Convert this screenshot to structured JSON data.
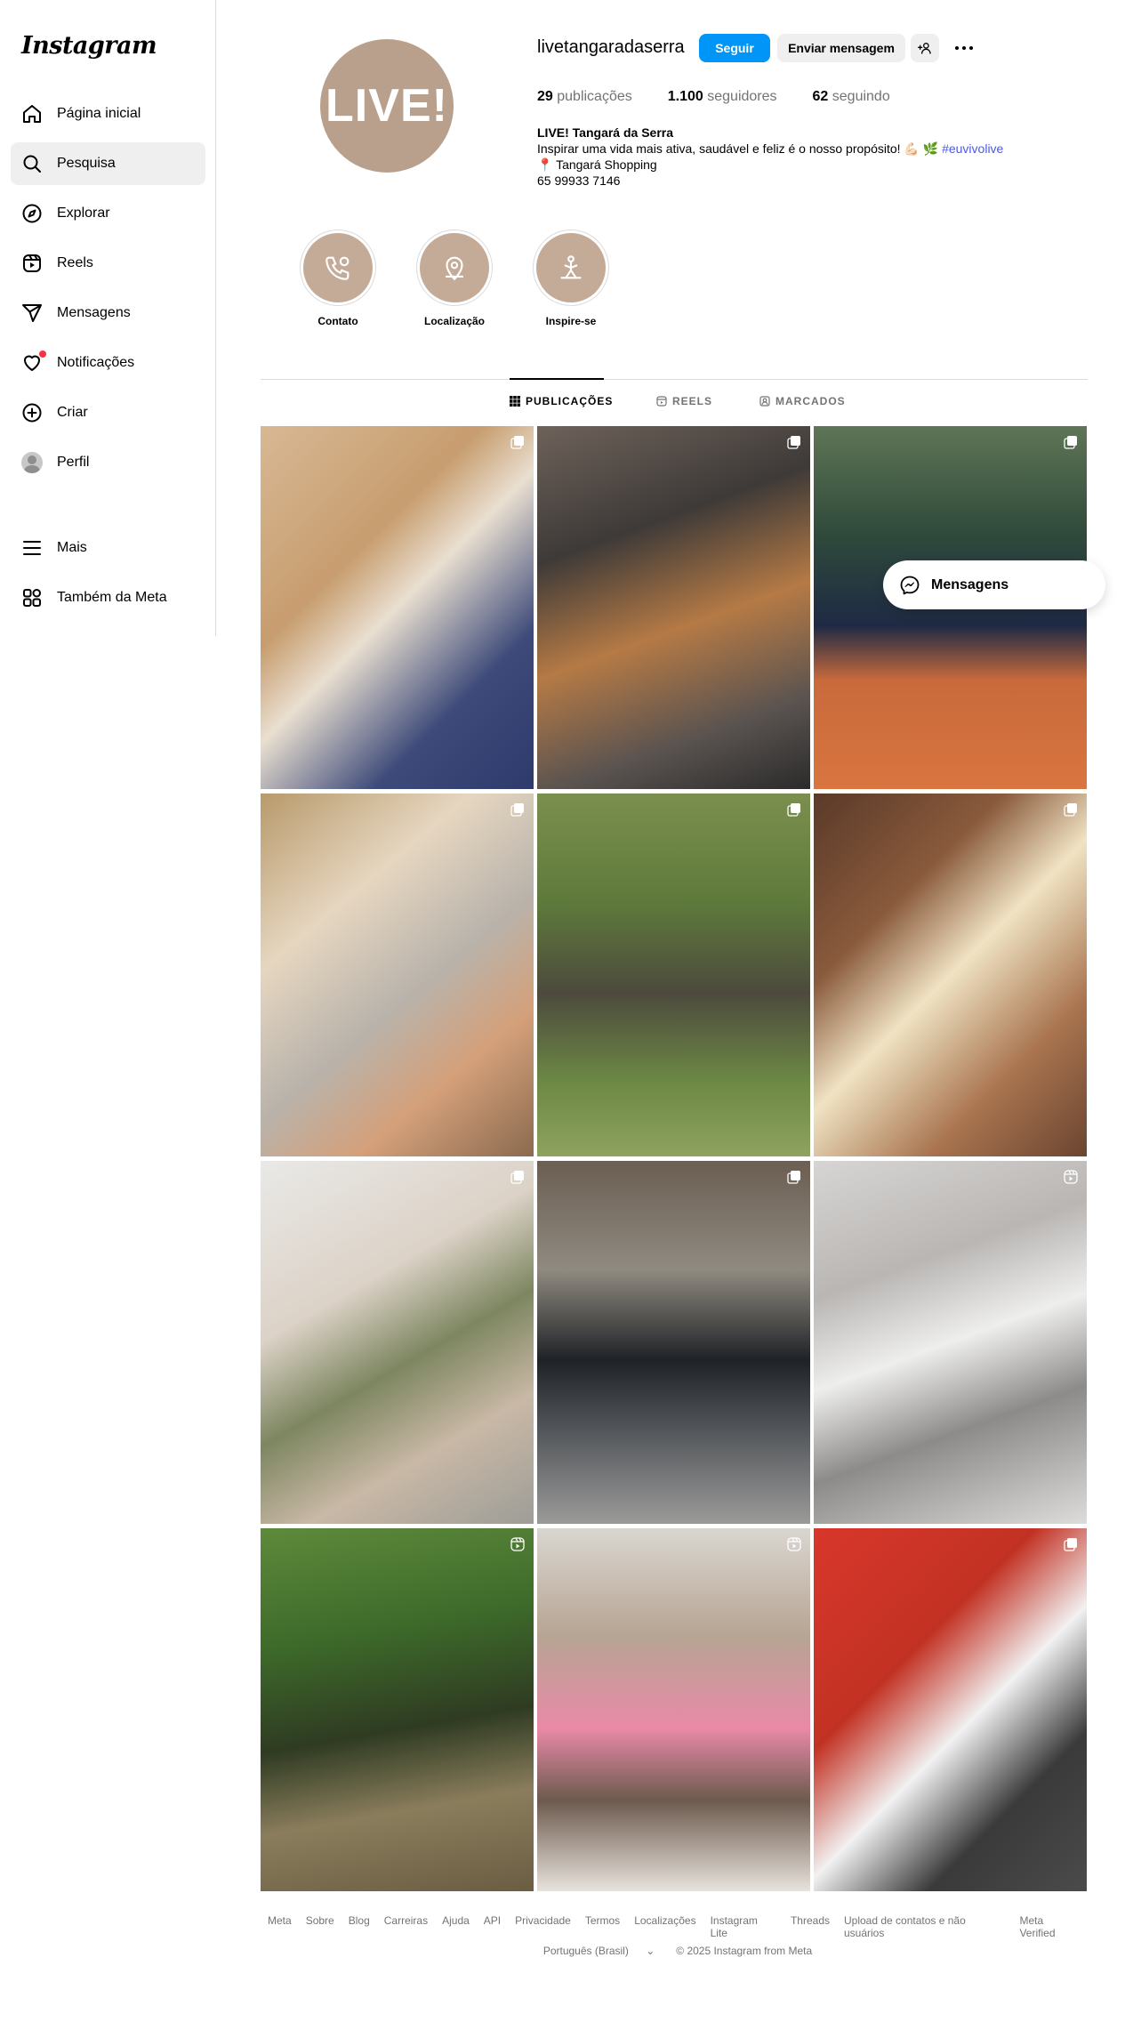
{
  "app": {
    "logo": "Instagram"
  },
  "sidebar": {
    "items": [
      {
        "label": "Página inicial",
        "icon": "home-icon"
      },
      {
        "label": "Pesquisa",
        "icon": "search-icon",
        "active": true
      },
      {
        "label": "Explorar",
        "icon": "compass-icon"
      },
      {
        "label": "Reels",
        "icon": "reels-icon"
      },
      {
        "label": "Mensagens",
        "icon": "send-icon"
      },
      {
        "label": "Notificações",
        "icon": "heart-icon"
      },
      {
        "label": "Criar",
        "icon": "plus-square-icon"
      },
      {
        "label": "Perfil",
        "icon": "avatar"
      },
      {
        "label": "Mais",
        "icon": "menu-icon"
      },
      {
        "label": "Também da Meta",
        "icon": "meta-apps-icon"
      }
    ]
  },
  "profile": {
    "avatar_text": "LIVE!",
    "avatar_color": "#b8a08c",
    "username": "livetangaradaserra",
    "follow_label": "Seguir",
    "message_label": "Enviar mensagem",
    "stats": {
      "posts_count": "29",
      "posts_label": "publicações",
      "followers_count": "1.100",
      "followers_label": "seguidores",
      "following_count": "62",
      "following_label": "seguindo"
    },
    "bio": {
      "name": "LIVE! Tangará da Serra",
      "line1": "Inspirar uma vida mais ativa, saudável e feliz é o nosso propósito! 💪🏻 🌿 ",
      "hashtag": "#euvivolive",
      "line2": "📍 Tangará Shopping",
      "line3": "65 99933 7146"
    }
  },
  "highlights": [
    {
      "label": "Contato"
    },
    {
      "label": "Localização"
    },
    {
      "label": "Inspire-se"
    }
  ],
  "tabs": [
    {
      "label": "PUBLICAÇÕES",
      "active": true
    },
    {
      "label": "REELS"
    },
    {
      "label": "MARCADOS"
    }
  ],
  "floating_messages": {
    "label": "Mensagens"
  },
  "posts": [
    {
      "type": "carousel"
    },
    {
      "type": "carousel"
    },
    {
      "type": "carousel"
    },
    {
      "type": "carousel"
    },
    {
      "type": "carousel"
    },
    {
      "type": "carousel"
    },
    {
      "type": "carousel"
    },
    {
      "type": "carousel"
    },
    {
      "type": "reel"
    },
    {
      "type": "reel"
    },
    {
      "type": "reel"
    },
    {
      "type": "carousel"
    }
  ],
  "footer": {
    "links": [
      "Meta",
      "Sobre",
      "Blog",
      "Carreiras",
      "Ajuda",
      "API",
      "Privacidade",
      "Termos",
      "Localizações",
      "Instagram Lite",
      "Threads",
      "Upload de contatos e não usuários",
      "Meta Verified"
    ],
    "language": "Português (Brasil)",
    "copyright": "© 2025 Instagram from Meta"
  }
}
